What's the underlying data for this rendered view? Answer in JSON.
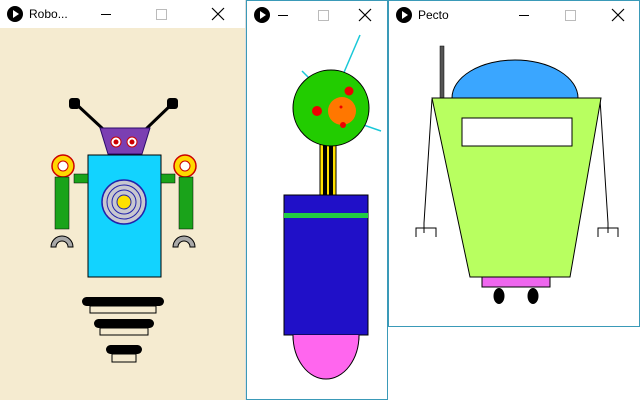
{
  "windows": [
    {
      "id": "robot-1",
      "title": "Robo...",
      "canvas_color": "#f5ebd0",
      "border_color": "#dddddd"
    },
    {
      "id": "robot-2",
      "title": "",
      "canvas_color": "#ffffff",
      "border_color": "#3a9ab8"
    },
    {
      "id": "robot-3",
      "title": "Pecto",
      "canvas_color": "#ffffff",
      "border_color": "#3a9ab8"
    }
  ],
  "icons": {
    "app": "processing-play-icon",
    "minimize": "minimize-icon",
    "maximize": "maximize-icon",
    "close": "close-icon"
  }
}
